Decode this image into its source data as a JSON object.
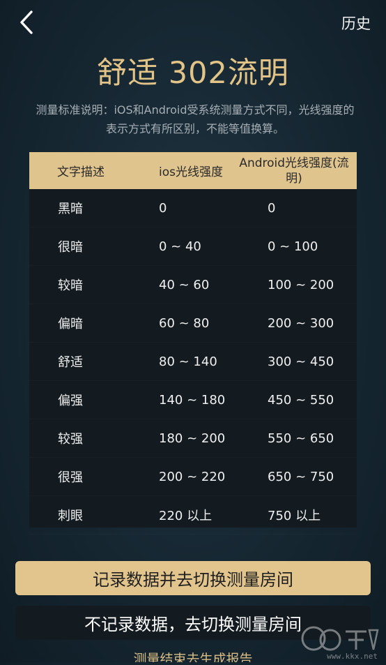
{
  "header": {
    "history_label": "历史"
  },
  "title": "舒适 302流明",
  "description": "测量标准说明：iOS和Android受系统测量方式不同，光线强度的表示方式有所区别，不能等值换算。",
  "table": {
    "headers": [
      "文字描述",
      "ios光线强度",
      "Android光线强度(流明)"
    ],
    "rows": [
      [
        "黑暗",
        "0",
        "0"
      ],
      [
        "很暗",
        "0 ~ 40",
        "0 ~ 100"
      ],
      [
        "较暗",
        "40 ~ 60",
        "100 ~ 200"
      ],
      [
        "偏暗",
        "60 ~ 80",
        "200 ~ 300"
      ],
      [
        "舒适",
        "80 ~ 140",
        "300 ~ 450"
      ],
      [
        "偏强",
        "140 ~ 180",
        "450 ~ 550"
      ],
      [
        "较强",
        "180 ~ 200",
        "550 ~ 650"
      ],
      [
        "很强",
        "200 ~ 220",
        "650 ~ 750"
      ],
      [
        "刺眼",
        "220 以上",
        "750 以上"
      ]
    ]
  },
  "buttons": {
    "record_and_switch": "记录数据并去切换测量房间",
    "switch_without_record": "不记录数据，去切换测量房间",
    "end_and_report": "测量结束去生成报告"
  },
  "watermark": {
    "text": "www.kkx.net"
  },
  "colors": {
    "accent_gold": "#e2c48d",
    "background": "#162732"
  },
  "icons": {
    "back": "chevron-left-icon"
  }
}
